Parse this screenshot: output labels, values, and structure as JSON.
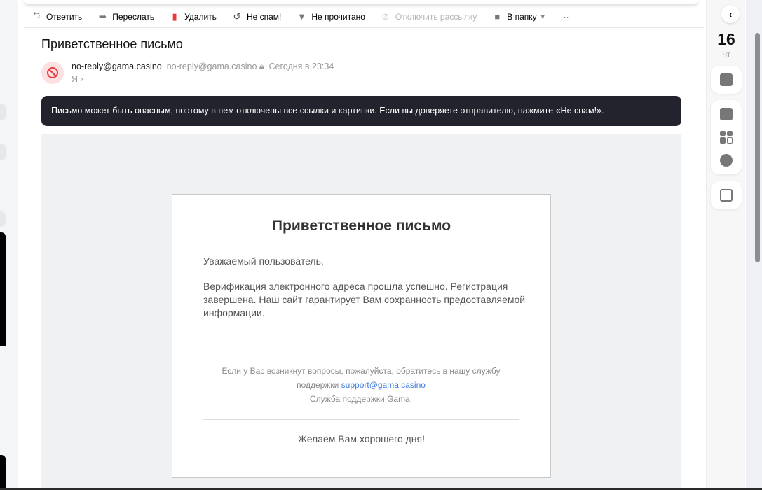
{
  "toolbar": {
    "reply": "Ответить",
    "forward": "Переслать",
    "delete": "Удалить",
    "not_spam": "Не спам!",
    "unread": "Не прочитано",
    "unsubscribe": "Отключить рассылку",
    "to_folder": "В папку",
    "more": "···"
  },
  "message": {
    "subject": "Приветственное письмо",
    "from_name": "no-reply@gama.casino",
    "from_email": "no-reply@gama.casino",
    "date": "Сегодня в 23:34",
    "to": "Я"
  },
  "warning": "Письмо может быть опасным, поэтому в нем отключены все ссылки и картинки. Если вы доверяете отправителю, нажмите «Не спам!».",
  "email_body": {
    "title": "Приветственное письмо",
    "greeting": "Уважаемый пользователь,",
    "text": "Верификация электронного адреса прошла успешно. Регистрация завершена. Наш сайт гарантирует Вам сохранность предоставляемой информации.",
    "support_text": "Если у Вас возникнут вопросы, пожалуйста, обратитесь в нашу службу поддержки",
    "support_email": "support@gama.casino",
    "support_sign": "Служба поддержки Gama.",
    "bye": "Желаем Вам хорошего дня!"
  },
  "calendar": {
    "day": "16",
    "weekday": "Чт"
  }
}
